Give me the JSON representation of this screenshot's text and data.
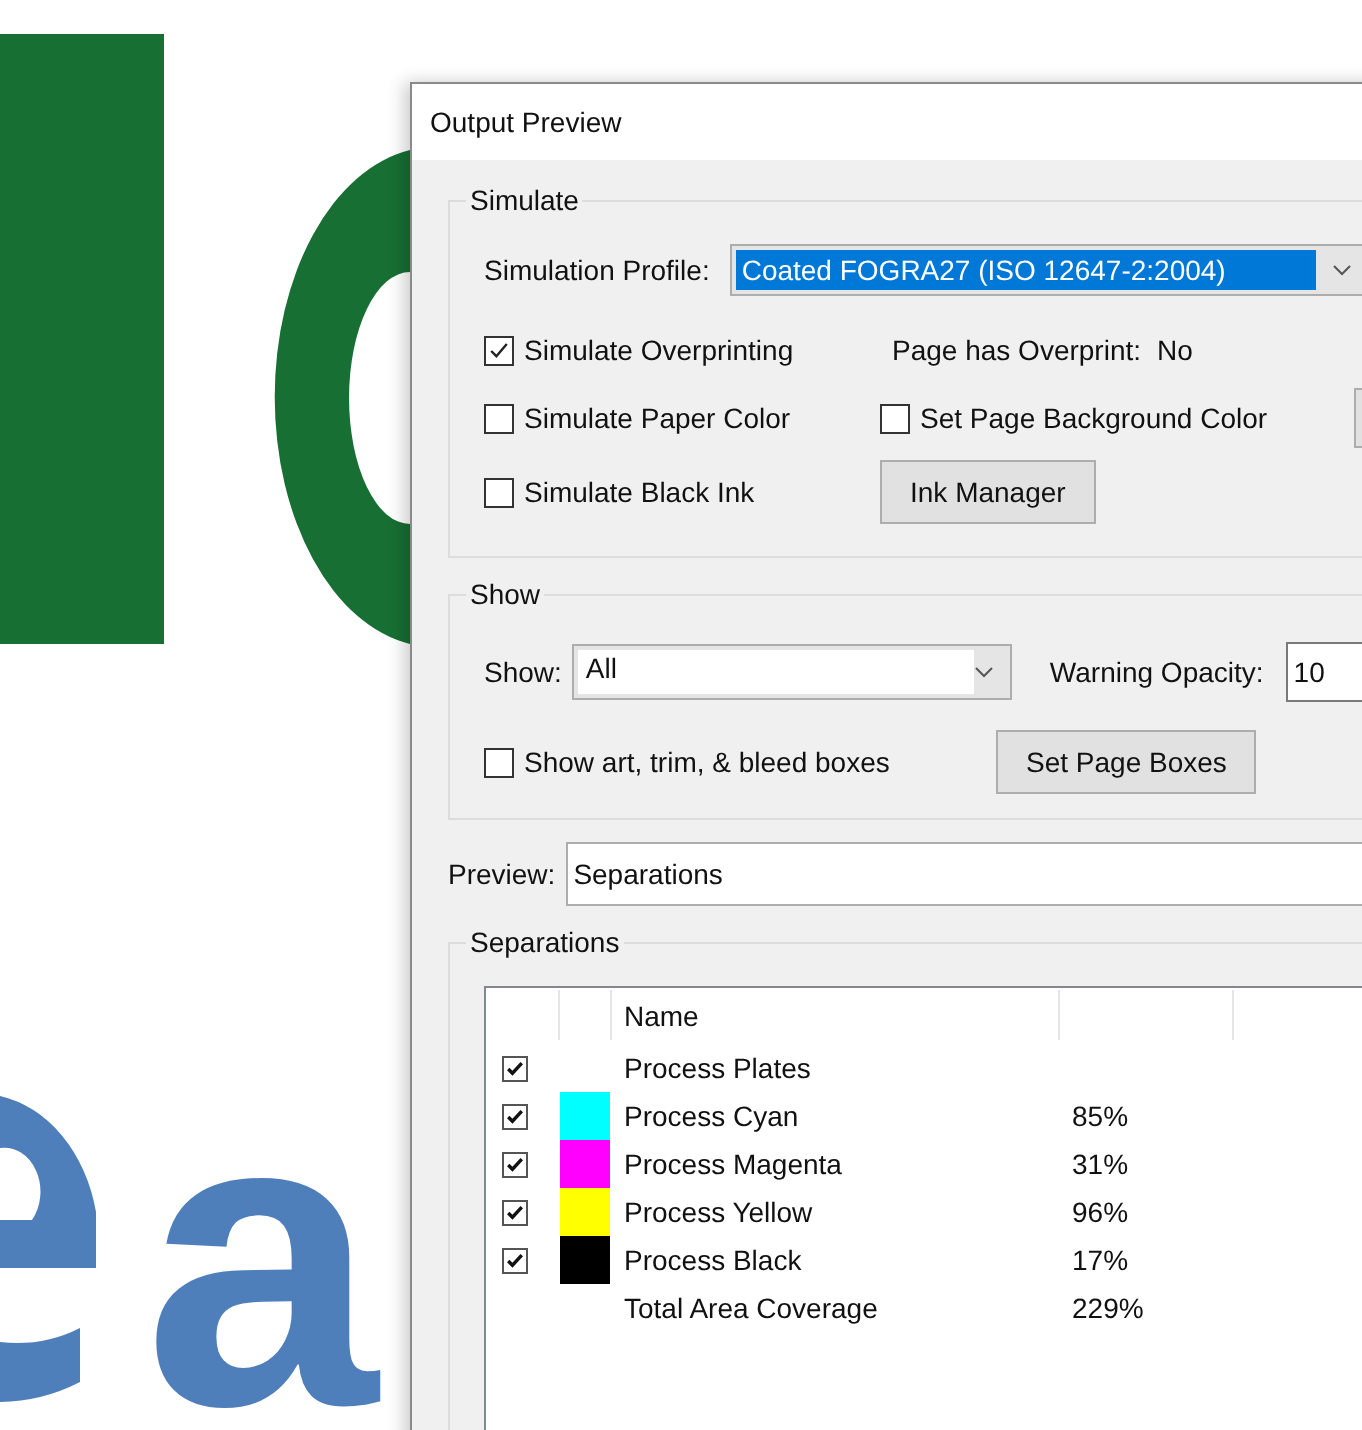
{
  "document": {
    "texts": [
      {
        "text": "a",
        "color": "#4e7fba"
      }
    ]
  },
  "window": {
    "title": "Output Preview"
  },
  "simulate": {
    "legend": "Simulate",
    "profile_label": "Simulation Profile:",
    "profile_value": "Coated FOGRA27 (ISO 12647-2:2004)",
    "overprinting": {
      "label": "Simulate Overprinting",
      "checked": true
    },
    "overprint_label": "Page has Overprint:",
    "overprint_value": "No",
    "paper_color": {
      "label": "Simulate Paper Color",
      "checked": false
    },
    "page_background": {
      "label": "Set Page Background Color",
      "checked": false
    },
    "black_ink": {
      "label": "Simulate Black Ink",
      "checked": false
    },
    "ink_manager_button": "Ink Manager"
  },
  "show": {
    "legend": "Show",
    "show_label": "Show:",
    "show_value": "All",
    "opacity_label": "Warning Opacity:",
    "opacity_value": "10",
    "boxes": {
      "label": "Show art, trim, & bleed boxes",
      "checked": false
    },
    "set_page_boxes_button": "Set Page Boxes"
  },
  "preview": {
    "label": "Preview:",
    "value": "Separations"
  },
  "separations": {
    "legend": "Separations",
    "columns": [
      "Name"
    ],
    "rows": [
      {
        "kind": "group",
        "name": "Process Plates",
        "checked": true
      },
      {
        "kind": "ink",
        "name": "Process Cyan",
        "checked": true,
        "color": "#00ffff",
        "coverage": "85%"
      },
      {
        "kind": "ink",
        "name": "Process Magenta",
        "checked": true,
        "color": "#ff00ff",
        "coverage": "31%"
      },
      {
        "kind": "ink",
        "name": "Process Yellow",
        "checked": true,
        "color": "#ffff00",
        "coverage": "96%"
      },
      {
        "kind": "ink",
        "name": "Process Black",
        "checked": true,
        "color": "#000000",
        "coverage": "17%"
      },
      {
        "kind": "total",
        "name": "Total Area Coverage",
        "coverage": "229%"
      }
    ]
  }
}
